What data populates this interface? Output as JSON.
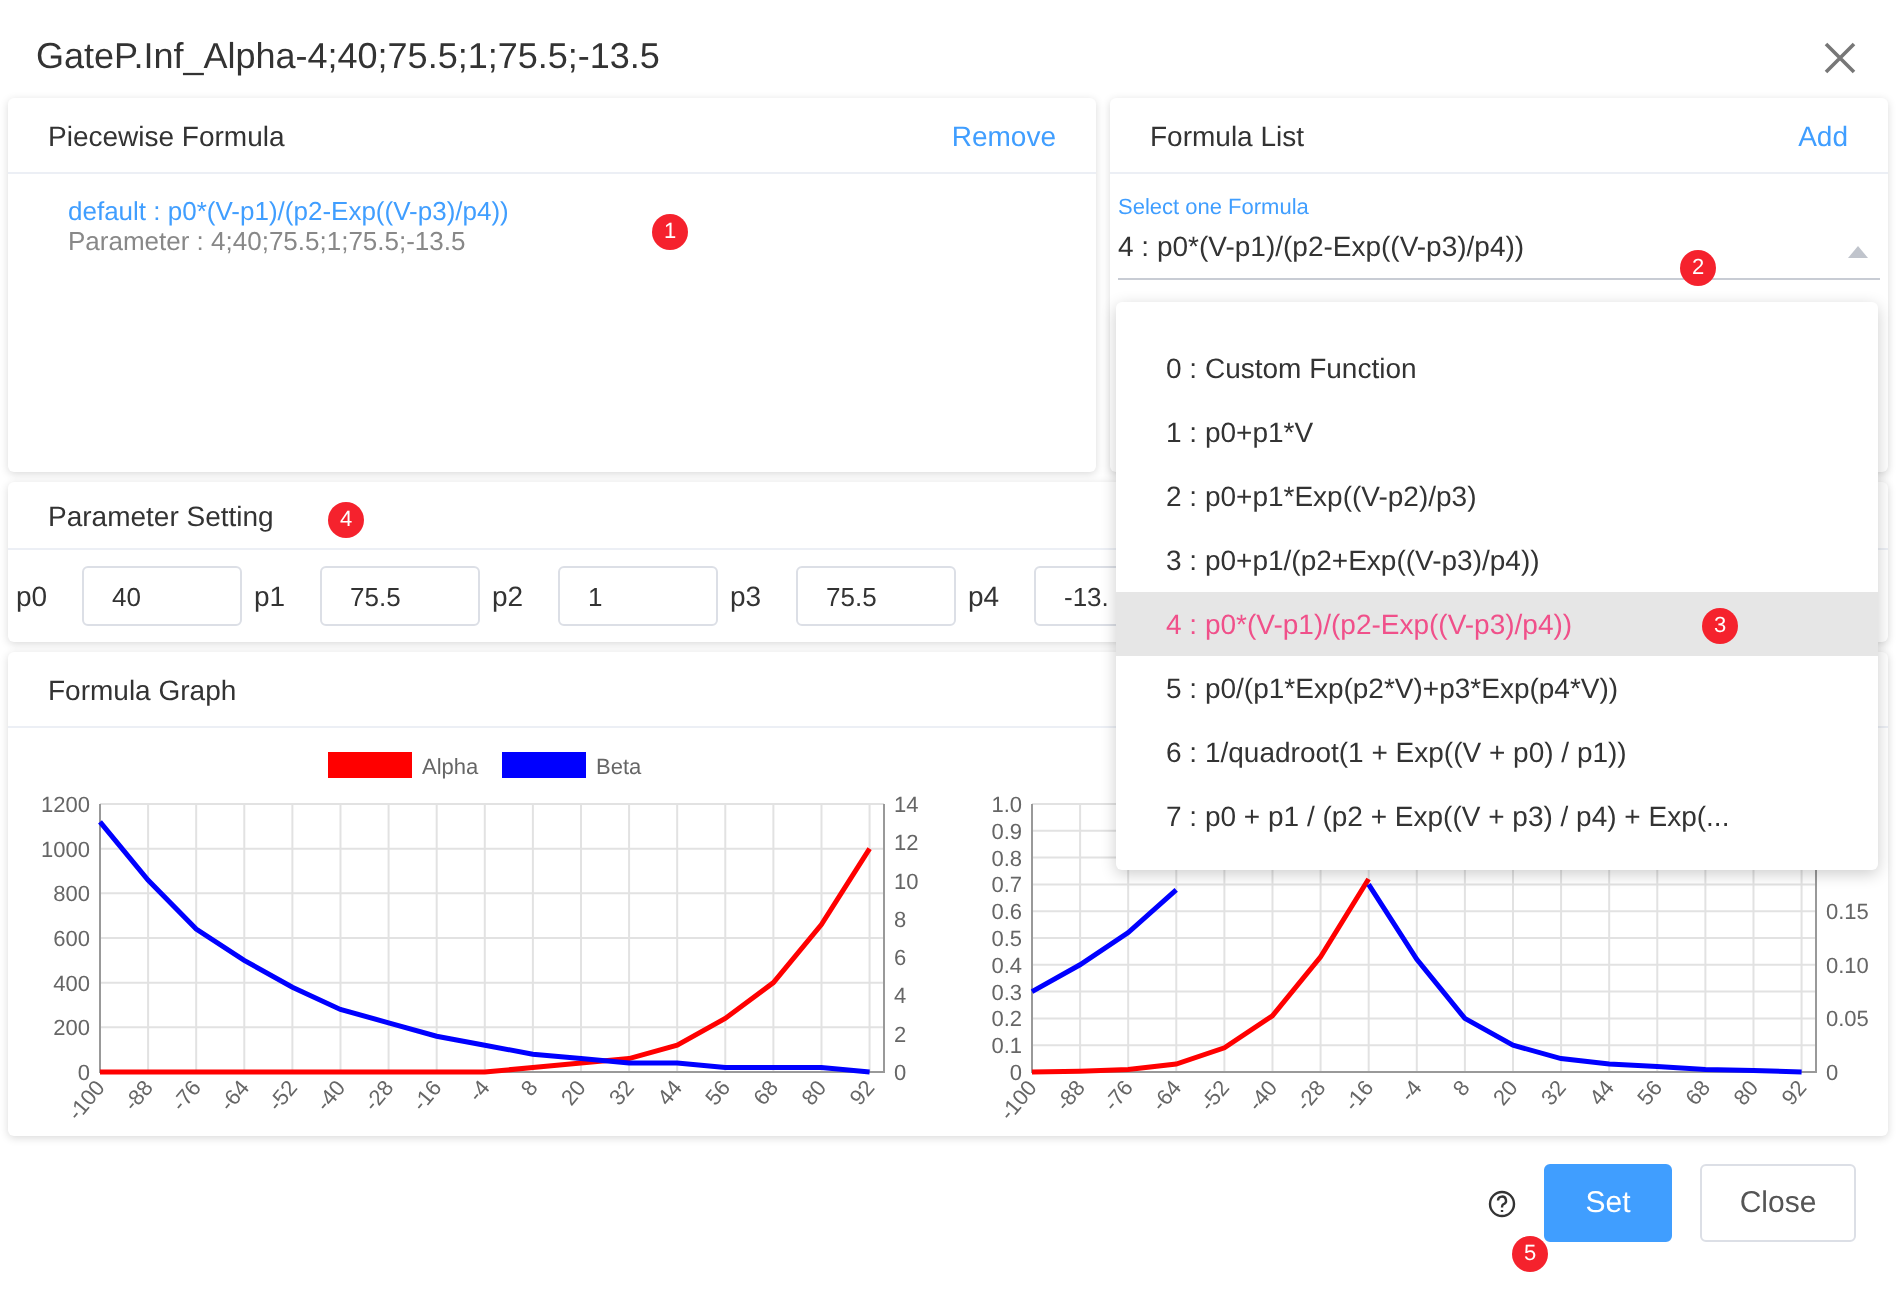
{
  "window": {
    "title": "GateP.Inf_Alpha-4;40;75.5;1;75.5;-13.5"
  },
  "piecewise": {
    "title": "Piecewise Formula",
    "action": "Remove",
    "badge": "1",
    "formula": "default : p0*(V-p1)/(p2-Exp((V-p3)/p4))",
    "parameter": "Parameter : 4;40;75.5;1;75.5;-13.5"
  },
  "formula_list": {
    "title": "Formula List",
    "action": "Add",
    "badge": "2",
    "select": {
      "label": "Select one Formula",
      "value": "4 : p0*(V-p1)/(p2-Exp((V-p3)/p4))",
      "expanded": true
    },
    "options": [
      {
        "label": "0 : Custom Function",
        "selected": false
      },
      {
        "label": "1 : p0+p1*V",
        "selected": false
      },
      {
        "label": "2 : p0+p1*Exp((V-p2)/p3)",
        "selected": false
      },
      {
        "label": "3 : p0+p1/(p2+Exp((V-p3)/p4))",
        "selected": false
      },
      {
        "label": "4 : p0*(V-p1)/(p2-Exp((V-p3)/p4))",
        "selected": true,
        "badge": "3"
      },
      {
        "label": "5 : p0/(p1*Exp(p2*V)+p3*Exp(p4*V))",
        "selected": false
      },
      {
        "label": "6 : 1/quadroot(1 + Exp((V + p0) / p1))",
        "selected": false
      },
      {
        "label": "7 : p0 + p1 / (p2 + Exp((V + p3) / p4) + Exp(...",
        "selected": false
      }
    ]
  },
  "parameter_setting": {
    "title": "Parameter Setting",
    "badge": "4",
    "params": [
      {
        "name": "p0",
        "value": "40"
      },
      {
        "name": "p1",
        "value": "75.5"
      },
      {
        "name": "p2",
        "value": "1"
      },
      {
        "name": "p3",
        "value": "75.5"
      },
      {
        "name": "p4",
        "value": "-13."
      }
    ]
  },
  "formula_graph": {
    "title": "Formula Graph",
    "charts": [
      {
        "chart_data": {
          "type": "line",
          "categories": [
            "-100",
            "-88",
            "-76",
            "-64",
            "-52",
            "-40",
            "-28",
            "-16",
            "-4",
            "8",
            "20",
            "32",
            "44",
            "56",
            "68",
            "80",
            "92"
          ],
          "ylim": [
            0,
            1200
          ],
          "yticks": [
            0,
            200,
            400,
            600,
            800,
            1000,
            1200
          ],
          "y2ticks": [
            0,
            2,
            4,
            6,
            8,
            10,
            12,
            14
          ],
          "y2lim": [
            0,
            14
          ],
          "grid": true,
          "legend": true,
          "series": [
            {
              "name": "Alpha",
              "color": "#ff0000",
              "values": [
                0,
                0,
                0,
                0,
                0,
                0,
                0,
                0,
                0,
                20,
                40,
                60,
                120,
                240,
                400,
                660,
                1000
              ]
            },
            {
              "name": "Beta",
              "color": "#0000ff",
              "values": [
                1120,
                860,
                640,
                500,
                380,
                280,
                220,
                160,
                120,
                80,
                60,
                40,
                40,
                20,
                20,
                20,
                0
              ]
            }
          ]
        }
      },
      {
        "chart_data": {
          "type": "line",
          "categories": [
            "-100",
            "-88",
            "-76",
            "-64",
            "-52",
            "-40",
            "-28",
            "-16",
            "-4",
            "8",
            "20",
            "32",
            "44",
            "56",
            "68",
            "80",
            "92"
          ],
          "ylim": [
            0,
            1
          ],
          "yticks": [
            0,
            0.1,
            0.2,
            0.3,
            0.4,
            0.5,
            0.6,
            0.7,
            0.8,
            0.9,
            {
              "value": 1,
              "label": "1.0"
            }
          ],
          "y2ticks": [
            0,
            0.05,
            {
              "value": 0.1,
              "label": "0.10"
            },
            0.15
          ],
          "y2lim": [
            0,
            0.25
          ],
          "grid": true,
          "legend": false,
          "series": [
            {
              "color": "#ff0000",
              "values": [
                0,
                0.003,
                0.01,
                0.03,
                0.09,
                0.21,
                0.43,
                0.72,
                null,
                null,
                null,
                null,
                null,
                null,
                null,
                null,
                null
              ]
            },
            {
              "color": "#0000ff",
              "values": [
                0.3,
                0.4,
                0.52,
                0.68,
                null,
                null,
                null,
                0.7,
                0.42,
                0.2,
                0.1,
                0.05,
                0.03,
                0.02,
                0.01,
                0.005,
                0
              ]
            }
          ]
        }
      }
    ]
  },
  "footer": {
    "badge": "5",
    "buttons": [
      {
        "label": "Set",
        "kind": "primary"
      },
      {
        "label": "Close",
        "kind": "default"
      }
    ]
  }
}
